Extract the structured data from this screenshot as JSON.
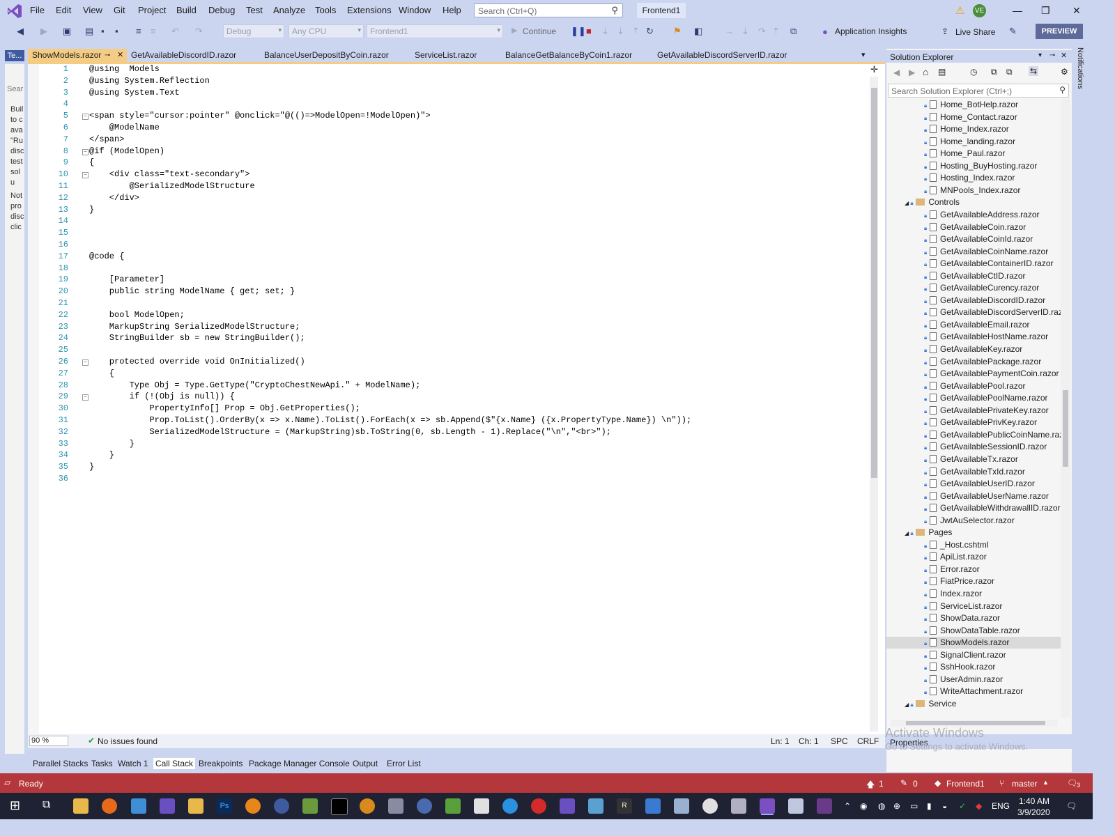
{
  "menu": {
    "items": [
      "File",
      "Edit",
      "View",
      "Git",
      "Project",
      "Build",
      "Debug",
      "Test",
      "Analyze",
      "Tools",
      "Extensions",
      "Window",
      "Help"
    ],
    "search_placeholder": "Search (Ctrl+Q)",
    "solution_name": "Frontend1",
    "user_initials": "VE"
  },
  "toolbar": {
    "config": "Debug",
    "platform": "Any CPU",
    "startup": "Frontend1",
    "continue_label": "Continue",
    "app_insights": "Application Insights",
    "live_share": "Live Share",
    "preview": "PREVIEW"
  },
  "left_panel": {
    "tab": "Te...",
    "search": "Sear",
    "text1": "Buil to c ava \"Ru disc test solu",
    "text2": "Not pro disc clic"
  },
  "doc_tabs": [
    {
      "label": "ShowModels.razor",
      "active": true
    },
    {
      "label": "GetAvailableDiscordID.razor",
      "active": false
    },
    {
      "label": "BalanceUserDepositByCoin.razor",
      "active": false
    },
    {
      "label": "ServiceList.razor",
      "active": false
    },
    {
      "label": "BalanceGetBalanceByCoin1.razor",
      "active": false
    },
    {
      "label": "GetAvailableDiscordServerID.razor",
      "active": false
    }
  ],
  "code_lines": [
    "@using  Models",
    "@using System.Reflection",
    "@using System.Text",
    "",
    "<span style=\"cursor:pointer\" @onclick=\"@(()=>ModelOpen=!ModelOpen)\">",
    "    @ModelName",
    "</span>",
    "@if (ModelOpen)",
    "{",
    "    <div class=\"text-secondary\">",
    "        @SerializedModelStructure",
    "    </div>",
    "}",
    "",
    "",
    "",
    "@code {",
    "",
    "    [Parameter]",
    "    public string ModelName { get; set; }",
    "",
    "    bool ModelOpen;",
    "    MarkupString SerializedModelStructure;",
    "    StringBuilder sb = new StringBuilder();",
    "",
    "    protected override void OnInitialized()",
    "    {",
    "        Type Obj = Type.GetType(\"CryptoChestNewApi.\" + ModelName);",
    "        if (!(Obj is null)) {",
    "            PropertyInfo[] Prop = Obj.GetProperties();",
    "            Prop.ToList().OrderBy(x => x.Name).ToList().ForEach(x => sb.Append($\"{x.Name} ({x.PropertyType.Name}) \\n\"));",
    "            SerializedModelStructure = (MarkupString)sb.ToString(0, sb.Length - 1).Replace(\"\\n\",\"<br>\");",
    "        }",
    "    }",
    "}",
    ""
  ],
  "editor_status": {
    "zoom": "90 %",
    "issues": "No issues found",
    "ln": "Ln: 1",
    "ch": "Ch: 1",
    "spc": "SPC",
    "crlf": "CRLF"
  },
  "bottom_tabs": [
    {
      "label": "Parallel Stacks",
      "active": false
    },
    {
      "label": "Tasks",
      "active": false
    },
    {
      "label": "Watch 1",
      "active": false
    },
    {
      "label": "Call Stack",
      "active": true
    },
    {
      "label": "Breakpoints",
      "active": false
    },
    {
      "label": "Package Manager Console",
      "active": false
    },
    {
      "label": "Output",
      "active": false
    },
    {
      "label": "Error List",
      "active": false
    }
  ],
  "solution_explorer": {
    "title": "Solution Explorer",
    "search_placeholder": "Search Solution Explorer (Ctrl+;)",
    "items": [
      {
        "label": "Home_BotHelp.razor",
        "type": "file"
      },
      {
        "label": "Home_Contact.razor",
        "type": "file"
      },
      {
        "label": "Home_Index.razor",
        "type": "file"
      },
      {
        "label": "Home_landing.razor",
        "type": "file"
      },
      {
        "label": "Home_Paul.razor",
        "type": "file"
      },
      {
        "label": "Hosting_BuyHosting.razor",
        "type": "file"
      },
      {
        "label": "Hosting_Index.razor",
        "type": "file"
      },
      {
        "label": "MNPools_Index.razor",
        "type": "file"
      },
      {
        "label": "Controls",
        "type": "folder"
      },
      {
        "label": "GetAvailableAddress.razor",
        "type": "file"
      },
      {
        "label": "GetAvailableCoin.razor",
        "type": "file"
      },
      {
        "label": "GetAvailableCoinId.razor",
        "type": "file"
      },
      {
        "label": "GetAvailableCoinName.razor",
        "type": "file"
      },
      {
        "label": "GetAvailableContainerID.razor",
        "type": "file"
      },
      {
        "label": "GetAvailableCtID.razor",
        "type": "file"
      },
      {
        "label": "GetAvailableCurency.razor",
        "type": "file"
      },
      {
        "label": "GetAvailableDiscordID.razor",
        "type": "file"
      },
      {
        "label": "GetAvailableDiscordServerID.razor",
        "type": "file"
      },
      {
        "label": "GetAvailableEmail.razor",
        "type": "file"
      },
      {
        "label": "GetAvailableHostName.razor",
        "type": "file"
      },
      {
        "label": "GetAvailableKey.razor",
        "type": "file"
      },
      {
        "label": "GetAvailablePackage.razor",
        "type": "file"
      },
      {
        "label": "GetAvailablePaymentCoin.razor",
        "type": "file"
      },
      {
        "label": "GetAvailablePool.razor",
        "type": "file"
      },
      {
        "label": "GetAvailablePoolName.razor",
        "type": "file"
      },
      {
        "label": "GetAvailablePrivateKey.razor",
        "type": "file"
      },
      {
        "label": "GetAvailablePrivKey.razor",
        "type": "file"
      },
      {
        "label": "GetAvailablePublicCoinName.razor",
        "type": "file"
      },
      {
        "label": "GetAvailableSessionID.razor",
        "type": "file"
      },
      {
        "label": "GetAvailableTx.razor",
        "type": "file"
      },
      {
        "label": "GetAvailableTxId.razor",
        "type": "file"
      },
      {
        "label": "GetAvailableUserID.razor",
        "type": "file"
      },
      {
        "label": "GetAvailableUserName.razor",
        "type": "file"
      },
      {
        "label": "GetAvailableWithdrawallID.razor",
        "type": "file"
      },
      {
        "label": "JwtAuSelector.razor",
        "type": "file"
      },
      {
        "label": "Pages",
        "type": "folder"
      },
      {
        "label": "_Host.cshtml",
        "type": "file"
      },
      {
        "label": "ApiList.razor",
        "type": "file"
      },
      {
        "label": "Error.razor",
        "type": "file"
      },
      {
        "label": "FiatPrice.razor",
        "type": "file"
      },
      {
        "label": "Index.razor",
        "type": "file"
      },
      {
        "label": "ServiceList.razor",
        "type": "file"
      },
      {
        "label": "ShowData.razor",
        "type": "file"
      },
      {
        "label": "ShowDataTable.razor",
        "type": "file"
      },
      {
        "label": "ShowModels.razor",
        "type": "file",
        "selected": true
      },
      {
        "label": "SignalClient.razor",
        "type": "file"
      },
      {
        "label": "SshHook.razor",
        "type": "file"
      },
      {
        "label": "UserAdmin.razor",
        "type": "file"
      },
      {
        "label": "WriteAttachment.razor",
        "type": "file"
      },
      {
        "label": "Service",
        "type": "folder"
      }
    ]
  },
  "properties": {
    "title": "Properties"
  },
  "right_strip": {
    "label": "Notifications"
  },
  "watermark": {
    "line1": "Activate Windows",
    "line2": "Go to Settings to activate Windows."
  },
  "status_bar": {
    "status": "Ready",
    "up": "1",
    "pencil": "0",
    "project": "Frontend1",
    "branch": "master",
    "notif": "3"
  },
  "taskbar": {
    "lang": "ENG",
    "time": "1:40 AM",
    "date": "3/9/2020"
  },
  "colors": {
    "chrome": "#ccd5f0",
    "active_tab": "#f5cc84",
    "status_bar": "#b4373b",
    "taskbar": "#1f2232"
  }
}
